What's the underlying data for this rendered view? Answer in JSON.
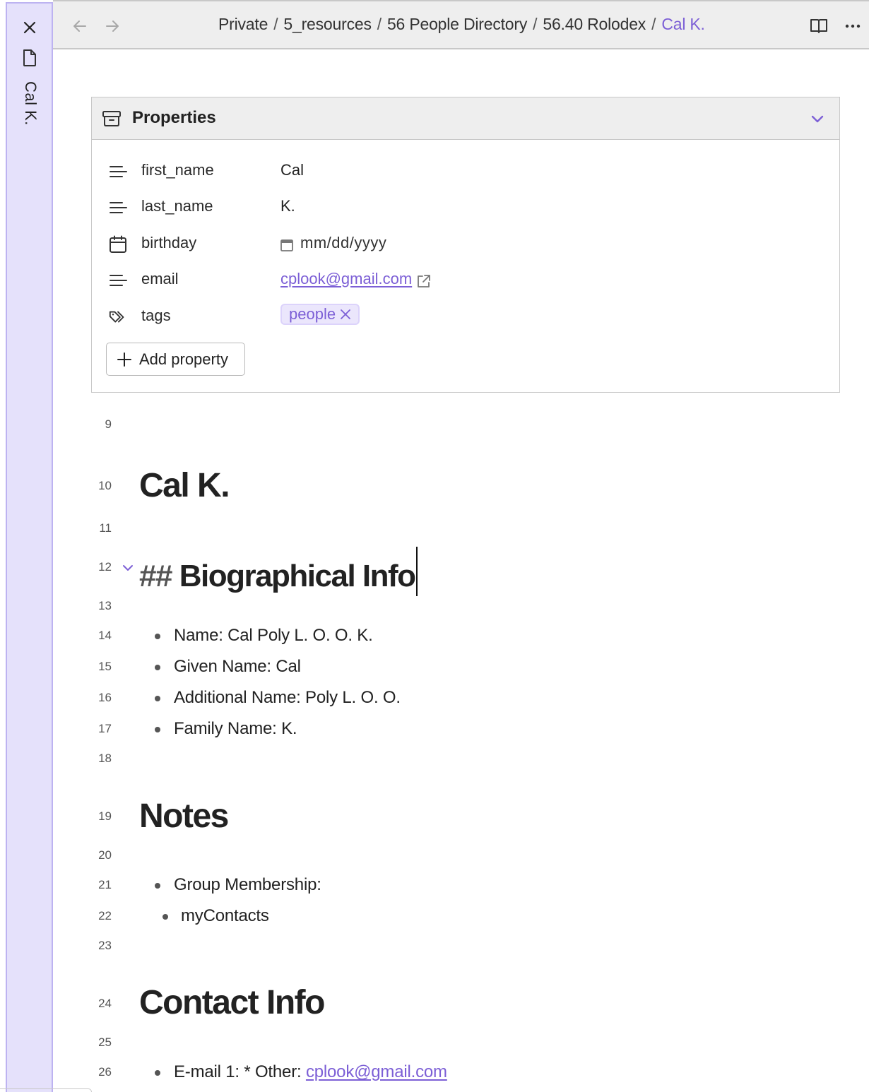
{
  "ribbon": {
    "tab_title": "Cal K.",
    "icons": [
      "close-icon",
      "file-icon"
    ]
  },
  "header": {
    "breadcrumb": [
      {
        "label": "Private"
      },
      {
        "label": "5_resources"
      },
      {
        "label": "56 People Directory"
      },
      {
        "label": "56.40 Rolodex"
      },
      {
        "label": "Cal K.",
        "current": true
      }
    ],
    "separator": "/",
    "icons": [
      "arrow-left-icon",
      "arrow-right-icon",
      "reading-view-icon",
      "more-options-icon"
    ]
  },
  "properties": {
    "title": "Properties",
    "rows": [
      {
        "icon": "text-icon",
        "key": "first_name",
        "value": "Cal"
      },
      {
        "icon": "text-icon",
        "key": "last_name",
        "value": "K."
      },
      {
        "icon": "calendar-icon",
        "key": "birthday",
        "value": "mm/dd/yyyy",
        "type": "date"
      },
      {
        "icon": "text-icon",
        "key": "email",
        "value": "cplook@gmail.com",
        "type": "link"
      },
      {
        "icon": "tags-icon",
        "key": "tags",
        "value": "people",
        "type": "tag"
      }
    ],
    "add_label": "Add property"
  },
  "editor": {
    "lines": [
      {
        "n": "9"
      },
      {
        "n": "10",
        "h1": "Cal K."
      },
      {
        "n": "11"
      },
      {
        "n": "12",
        "h2_prefix": "##",
        "h2": "Biographical Info"
      },
      {
        "n": "13"
      },
      {
        "n": "14",
        "text": "Name: Cal Poly L. O. O. K."
      },
      {
        "n": "15",
        "text": "Given Name: Cal"
      },
      {
        "n": "16",
        "text": "Additional Name: Poly L. O. O."
      },
      {
        "n": "17",
        "text": "Family Name: K."
      },
      {
        "n": "18"
      },
      {
        "n": "19",
        "h1": "Notes"
      },
      {
        "n": "20"
      },
      {
        "n": "21",
        "text": "Group Membership:"
      },
      {
        "n": "22",
        "text": "myContacts"
      },
      {
        "n": "23"
      },
      {
        "n": "24",
        "h1": "Contact Info"
      },
      {
        "n": "25"
      },
      {
        "n": "26",
        "text_prefix": "E-mail 1: * Other: ",
        "link": "cplook@gmail.com"
      }
    ]
  },
  "colors": {
    "accent": "#7c5fd6",
    "ribbon_bg": "#e5e1fb",
    "ribbon_border": "#bdb3f1",
    "header_bg": "#eeeeee",
    "tag_bg": "#ebe6fc"
  }
}
